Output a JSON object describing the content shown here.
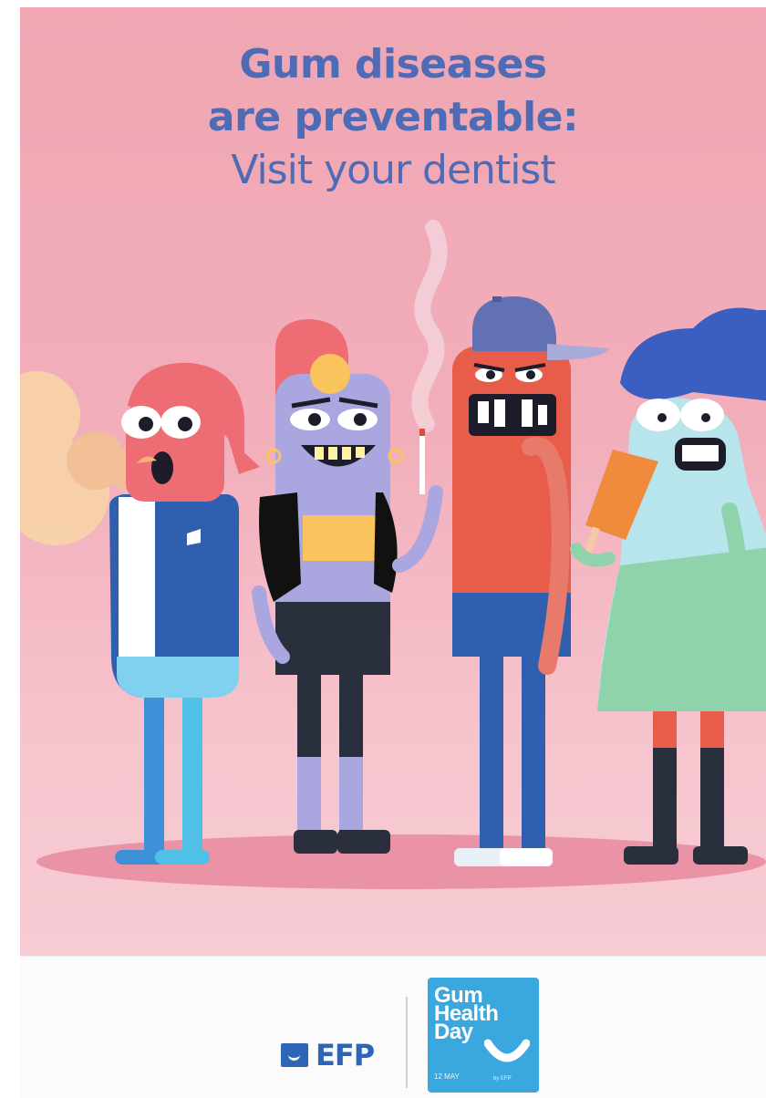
{
  "poster": {
    "headline_line1": "Gum diseases",
    "headline_line2": "are preventable:",
    "headline_line3": "Visit your dentist"
  },
  "footer": {
    "efp_logo_text": "EFP",
    "ghd_line1": "Gum",
    "ghd_line2": "Health",
    "ghd_line3": "Day",
    "ghd_date": "12 MAY",
    "ghd_byline": "by EFP"
  },
  "colors": {
    "poster_background": "#f2aebb",
    "headline": "#4e6bb5",
    "efp_blue": "#2d65b7",
    "gum_health_day_blue": "#3aa8df"
  },
  "icons": [
    "efp-smile-icon",
    "gum-health-day-smile-icon"
  ]
}
